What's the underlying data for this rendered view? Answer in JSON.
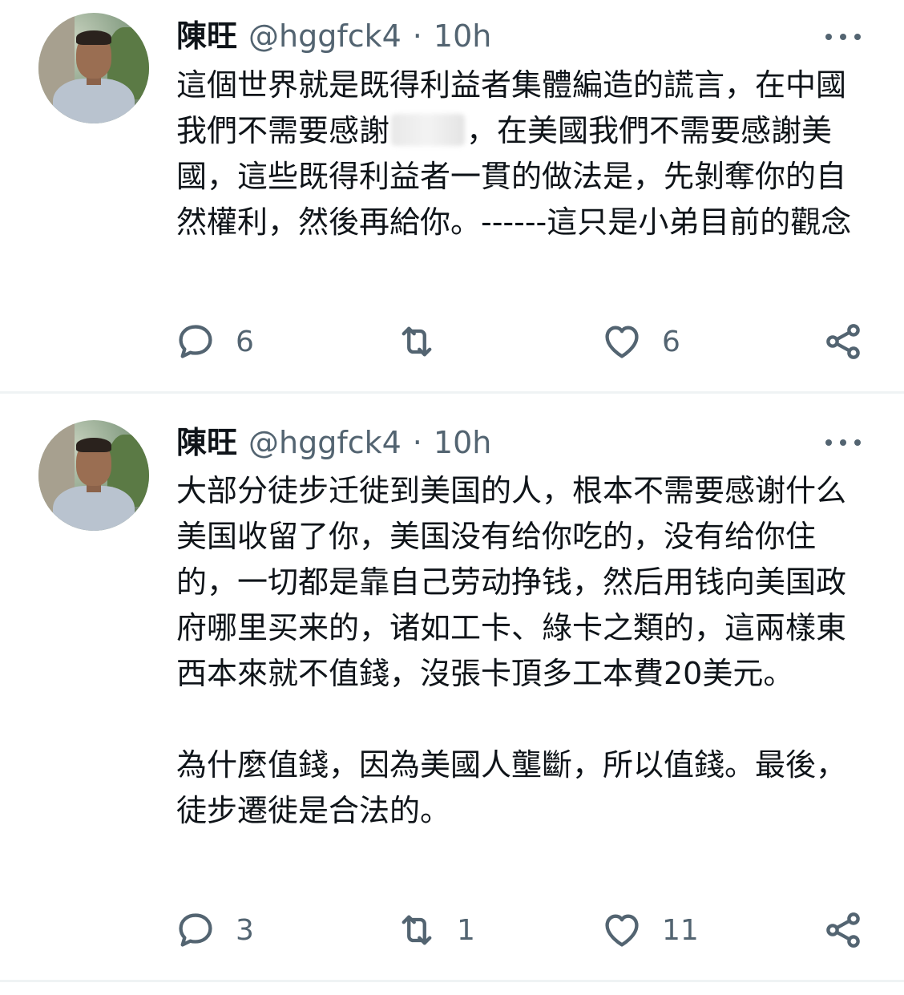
{
  "tweets": [
    {
      "author": {
        "name": "陳旺",
        "handle": "@hggfck4",
        "separator": "·",
        "time": "10h"
      },
      "body_parts": [
        "這個世界就是既得利益者集體編造的謊言，在中國我們不需要感謝",
        "，在美國我們不需要感謝美國，這些既得利益者一貫的做法是，先剝奪你的自然權利，然後再給你。------這只是小弟目前的觀念"
      ],
      "stats": {
        "replies": "6",
        "retweets": "",
        "likes": "6"
      },
      "icons": {
        "reply": "reply-icon",
        "retweet": "retweet-icon",
        "like": "heart-icon",
        "share": "share-icon",
        "more": "more-icon"
      }
    },
    {
      "author": {
        "name": "陳旺",
        "handle": "@hggfck4",
        "separator": "·",
        "time": "10h"
      },
      "body": "大部分徒步迁徙到美国的人，根本不需要感谢什么美国收留了你，美国没有给你吃的，没有给你住的，一切都是靠自己劳动挣钱，然后用钱向美国政府哪里买来的，诸如工卡、綠卡之類的，這兩樣東西本來就不值錢，沒張卡頂多工本費20美元。\n\n為什麼值錢，因為美國人壟斷，所以值錢。最後，徒步遷徙是合法的。",
      "stats": {
        "replies": "3",
        "retweets": "1",
        "likes": "11"
      },
      "icons": {
        "reply": "reply-icon",
        "retweet": "retweet-icon",
        "like": "heart-icon",
        "share": "share-icon",
        "more": "more-icon"
      }
    }
  ],
  "colors": {
    "text": "#0f1419",
    "secondary": "#536471",
    "divider": "#eff3f4",
    "background": "#ffffff"
  }
}
